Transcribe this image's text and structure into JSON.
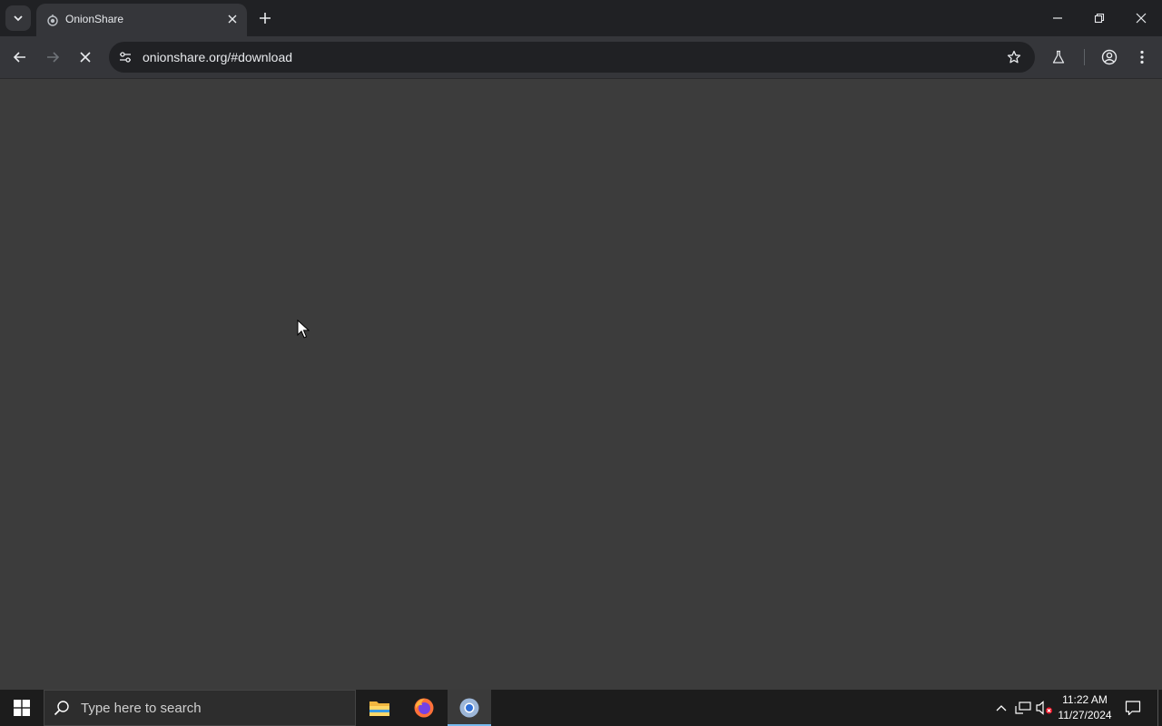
{
  "browser": {
    "tab": {
      "title": "OnionShare"
    },
    "address_bar": {
      "url": "onionshare.org/#download"
    }
  },
  "taskbar": {
    "search_placeholder": "Type here to search",
    "clock": {
      "time": "11:22 AM",
      "date": "11/27/2024"
    }
  },
  "colors": {
    "page_background": "#3c3c3c",
    "chrome_background": "#202124",
    "toolbar_background": "#35363a",
    "taskbar_background": "#1c1c1c",
    "active_app_indicator": "#76b9ed"
  }
}
